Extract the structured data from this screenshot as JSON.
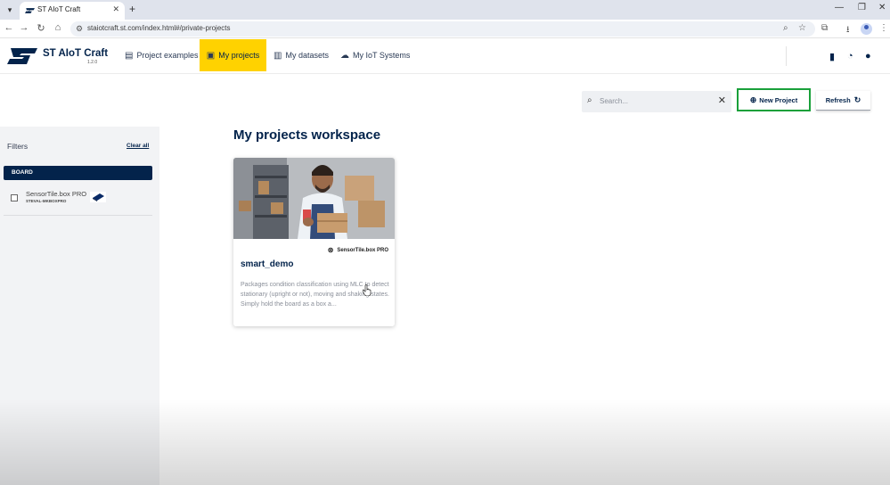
{
  "browser": {
    "tab_title": "ST AIoT Craft",
    "url": "staiotcraft.st.com/index.html#/private-projects"
  },
  "app": {
    "brand": "ST AIoT Craft",
    "version": "1.2.0",
    "nav": [
      {
        "label": "Project examples",
        "icon": "grid-icon"
      },
      {
        "label": "My projects",
        "icon": "folder-user-icon"
      },
      {
        "label": "My datasets",
        "icon": "dataset-icon"
      },
      {
        "label": "My IoT Systems",
        "icon": "cloud-icon"
      }
    ],
    "active_nav": "My projects",
    "accent_color": "#ffd200",
    "brand_color": "#03234b"
  },
  "sidebar": {
    "title": "Filters",
    "clear_all": "Clear all",
    "board_header": "BOARD",
    "boards": [
      {
        "name": "SensorTile.box PRO",
        "code": "STEVAL-MKBOXPRO",
        "checked": false
      }
    ]
  },
  "toolbar": {
    "search_placeholder": "Search...",
    "new_project_label": "New Project",
    "refresh_label": "Refresh"
  },
  "main": {
    "title": "My projects workspace",
    "projects": [
      {
        "board": "SensorTile.box PRO",
        "name": "smart_demo",
        "description": "Packages condition classification using MLC to detect stationary (upright or not), moving and shaking states. Simply hold the board as a box a..."
      }
    ]
  }
}
